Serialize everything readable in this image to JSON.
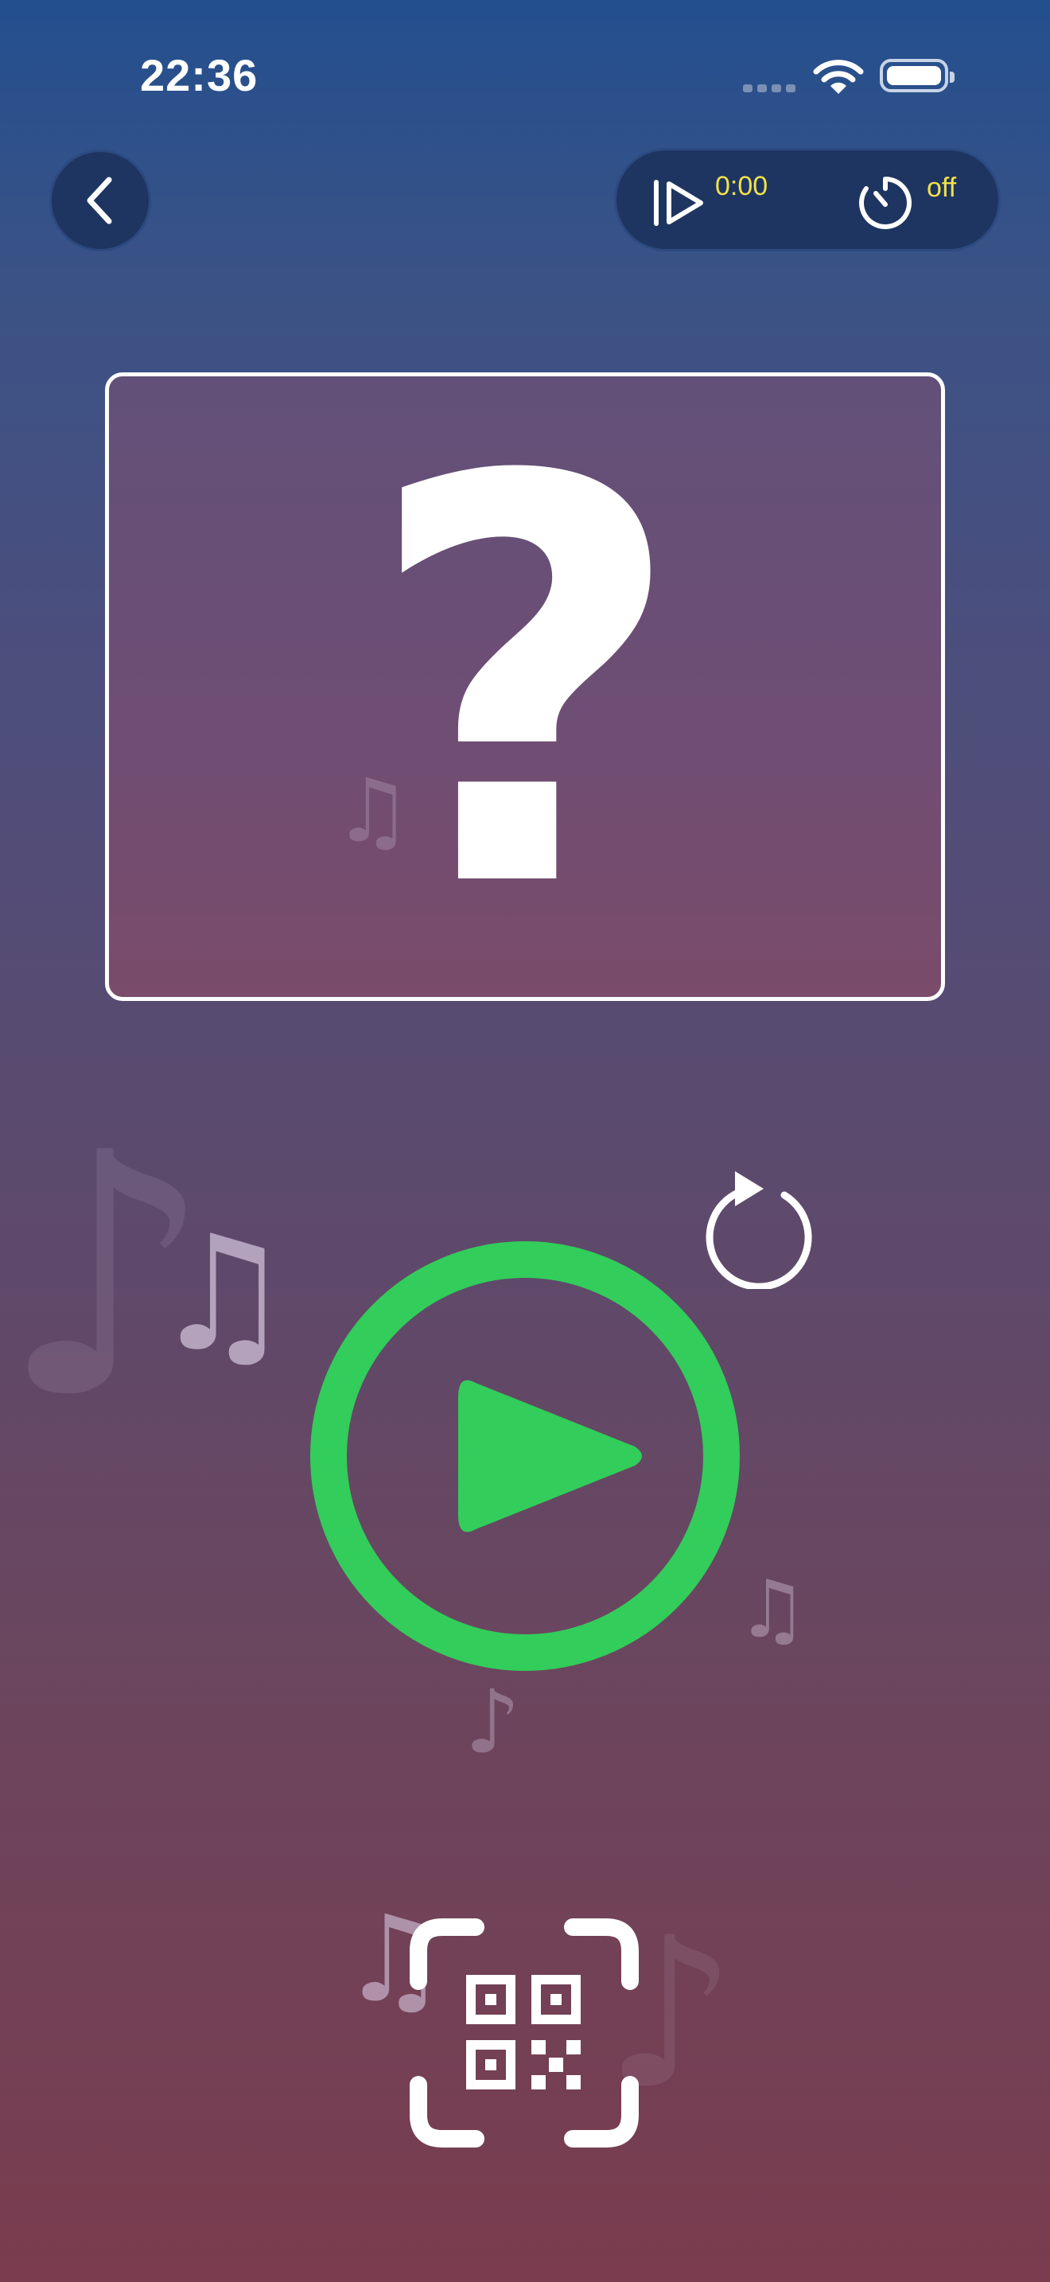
{
  "status_bar": {
    "time": "22:36"
  },
  "top_controls": {
    "play_time": "0:00",
    "timer": "off"
  },
  "card": {
    "symbol": "?"
  },
  "colors": {
    "accent_green": "#32cd5a",
    "value_yellow": "#f0e14a",
    "pill_bg": "#1f3561"
  },
  "icons": [
    "chevron-left-icon",
    "play-from-start-icon",
    "timer-icon",
    "replay-icon",
    "play-icon",
    "qr-scan-icon",
    "music-note-icon"
  ]
}
